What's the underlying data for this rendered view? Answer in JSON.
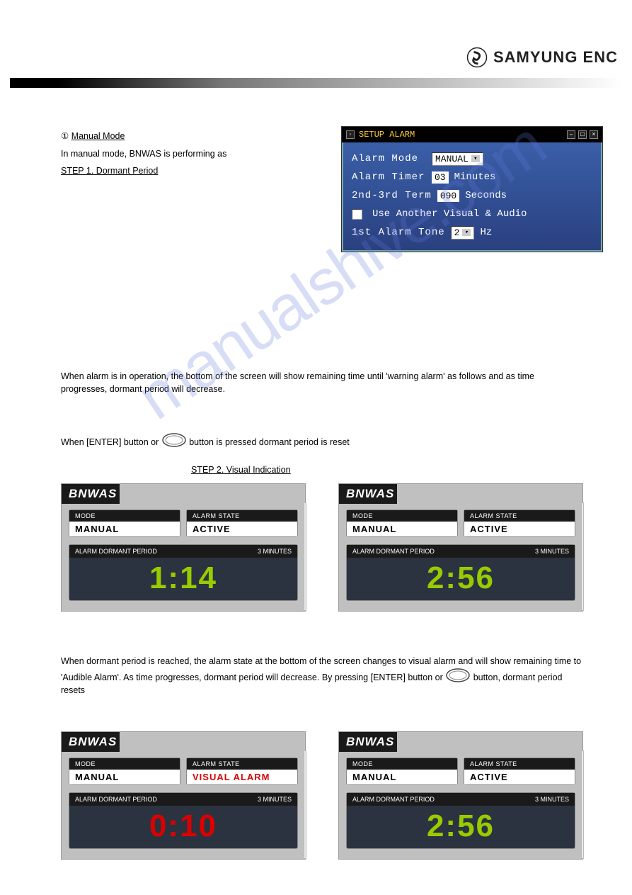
{
  "header": {
    "brand": "SAMYUNG ENC"
  },
  "sections": {
    "manual_mode_label": "Manual Mode",
    "intro": "In manual mode, BNWAS is performing as",
    "step1": "STEP 1. Dormant Period",
    "step1_body": "When alarm is in operation, the bottom of the screen will show remaining time until 'warning alarm' as follows and as time progresses, dormant period will decrease.",
    "enter_prompt": "When [ENTER] button or",
    "enter_prompt2": "button is pressed dormant period is reset",
    "step2": "STEP 2. Visual Indication",
    "step2_body": "When dormant period is reached, the alarm state at the bottom of the screen changes to visual alarm and will show remaining time to 'Audible Alarm'. As time progresses, dormant period will decrease. By pressing [ENTER] button or",
    "step2_body2": "button, dormant period resets"
  },
  "setup_alarm": {
    "title": "SETUP ALARM",
    "rows": {
      "mode_label": "Alarm Mode",
      "mode_value": "MANUAL",
      "timer_label": "Alarm Timer",
      "timer_value": "03",
      "timer_unit": "Minutes",
      "term_label": "2nd-3rd Term",
      "term_value": "090",
      "term_unit": "Seconds",
      "use_another": "Use Another Visual & Audio",
      "tone_label": "1st Alarm Tone",
      "tone_value": "2",
      "tone_unit": "Hz"
    }
  },
  "bnwas_common": {
    "title": "BNWAS",
    "mode_label": "MODE",
    "state_label": "ALARM STATE",
    "period_label": "ALARM DORMANT PERIOD",
    "minutes_label": "3 MINUTES"
  },
  "panels": [
    {
      "mode": "MANUAL",
      "state": "ACTIVE",
      "state_color": "normal",
      "time": "1:14",
      "time_color": "green"
    },
    {
      "mode": "MANUAL",
      "state": "ACTIVE",
      "state_color": "normal",
      "time": "2:56",
      "time_color": "green"
    },
    {
      "mode": "MANUAL",
      "state": "VISUAL ALARM",
      "state_color": "red",
      "time": "0:10",
      "time_color": "red"
    },
    {
      "mode": "MANUAL",
      "state": "ACTIVE",
      "state_color": "normal",
      "time": "2:56",
      "time_color": "green"
    }
  ],
  "watermark": "manualshive.com"
}
